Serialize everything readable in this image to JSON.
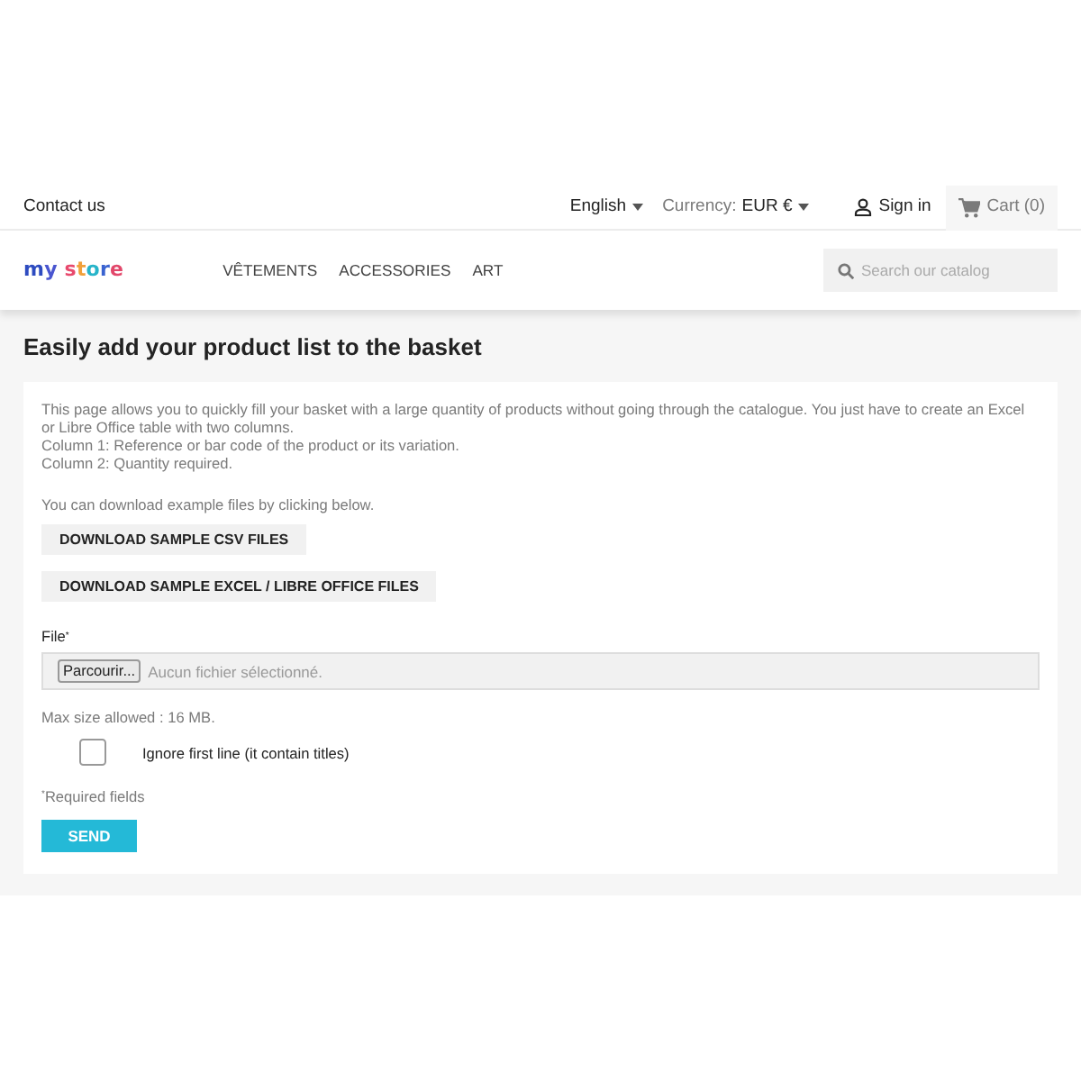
{
  "header": {
    "contact_link": "Contact us",
    "language": {
      "label": "English"
    },
    "currency": {
      "label": "Currency:",
      "value": "EUR €"
    },
    "sign_in": "Sign in",
    "cart": "Cart (0)"
  },
  "logo": "my store",
  "menu": [
    {
      "label": "VÊTEMENTS"
    },
    {
      "label": "ACCESSORIES"
    },
    {
      "label": "ART"
    }
  ],
  "search": {
    "placeholder": "Search our catalog"
  },
  "page_title": "Easily add your product list to the basket",
  "form": {
    "description": [
      "This page allows you to quickly fill your basket with a large quantity of products without going through the catalogue. You just have to create an Excel or Libre Office table with two columns.",
      "Column 1: Reference or bar code of the product or its variation.",
      "Column 2: Quantity required."
    ],
    "download_hint": "You can download example files by clicking below.",
    "download_buttons": [
      "DOWNLOAD SAMPLE CSV FILES",
      "DOWNLOAD SAMPLE EXCEL / LIBRE OFFICE FILES"
    ],
    "file_label": "File$^{*}$",
    "file_input": {
      "button": "Parcourir...",
      "status": "Aucun fichier sélectionné."
    },
    "max_size": "Max size allowed : 16 MB.",
    "ignore_first_line": {
      "label": "Ignore first line (it contain titles)",
      "checked": false
    },
    "required_note": "$^{*}$Required fields",
    "submit": "SEND"
  }
}
